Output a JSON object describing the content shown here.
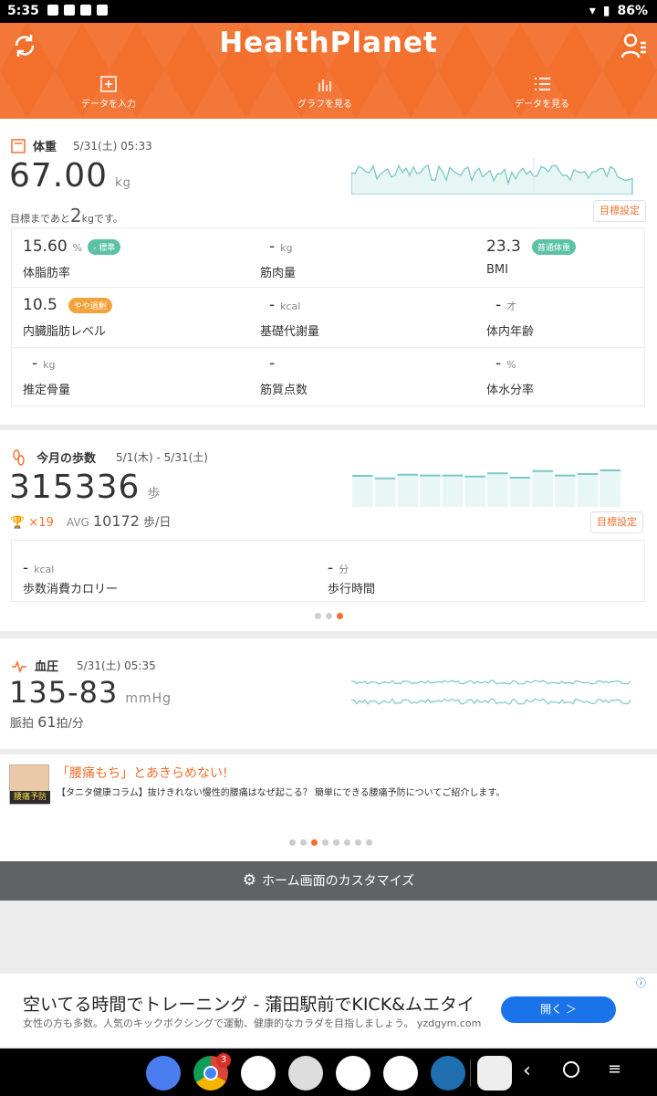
{
  "status": {
    "time": "5:35",
    "battery": "86%"
  },
  "header": {
    "logo": "HealthPlanet",
    "nav": [
      {
        "label": "データを入力"
      },
      {
        "label": "グラフを見る"
      },
      {
        "label": "データを見る"
      }
    ]
  },
  "weight": {
    "title": "体重",
    "date": "5/31(土) 05:33",
    "value": "67.00",
    "unit": "kg",
    "note_pre": "目標まであと",
    "note_num": "2",
    "note_post": "kgです。",
    "goal_btn": "目標設定",
    "metrics": [
      {
        "value": "15.60",
        "unit": "%",
        "label": "体脂肪率",
        "badge": "- 標準",
        "badge_color": "#5bc2a6"
      },
      {
        "value": "-",
        "unit": "kg",
        "label": "筋肉量"
      },
      {
        "value": "23.3",
        "unit": "",
        "label": "BMI",
        "badge": "普通体重",
        "badge_color": "#5bc2a6"
      },
      {
        "value": "10.5",
        "unit": "",
        "label": "内臓脂肪レベル",
        "badge": "やや過剰",
        "badge_color": "#f4a23c"
      },
      {
        "value": "-",
        "unit": "kcal",
        "label": "基礎代謝量"
      },
      {
        "value": "-",
        "unit": "才",
        "label": "体内年齢"
      },
      {
        "value": "-",
        "unit": "kg",
        "label": "推定骨量"
      },
      {
        "value": "-",
        "unit": "",
        "label": "筋質点数"
      },
      {
        "value": "-",
        "unit": "%",
        "label": "体水分率"
      }
    ]
  },
  "steps": {
    "title": "今月の歩数",
    "date": "5/1(木) - 5/31(土)",
    "value": "315336",
    "unit": "歩",
    "trophy": "×19",
    "avg_label": "AVG",
    "avg": "10172",
    "avg_unit": "歩/日",
    "goal_btn": "目標設定",
    "metrics": [
      {
        "value": "-",
        "unit": "kcal",
        "label": "歩数消費カロリー"
      },
      {
        "value": "-",
        "unit": "分",
        "label": "歩行時間"
      }
    ],
    "bars": [
      0.85,
      0.78,
      0.88,
      0.86,
      0.86,
      0.83,
      0.92,
      0.8,
      0.98,
      0.86,
      0.9,
      1.0
    ]
  },
  "bp": {
    "title": "血圧",
    "date": "5/31(土) 05:35",
    "value": "135-83",
    "unit": "mmHg",
    "pulse_label": "脈拍",
    "pulse": "61",
    "pulse_unit": "拍/分"
  },
  "news": {
    "thumb": "腰痛予防",
    "title": "「腰痛もち」とあきらめない!",
    "body": "【タニタ健康コラム】抜けきれない慢性的腰痛はなぜ起こる？ 簡単にできる腰痛予防についてご紹介します。"
  },
  "customize": {
    "label": "ホーム画面のカスタマイズ"
  },
  "ad": {
    "title": "空いてる時間でトレーニング - 蒲田駅前でKICK&ムエタイ",
    "sub": "女性の方も多数。人気のキックボクシングで運動、健康的なカラダを目指しましょう。 yzdgym.com",
    "button": "開く ＞"
  },
  "dock": {
    "chrome_badge": "3"
  },
  "colors": {
    "accent": "#f26f2c",
    "teal": "#5bc2a6",
    "chart": "#7cc8c6"
  }
}
